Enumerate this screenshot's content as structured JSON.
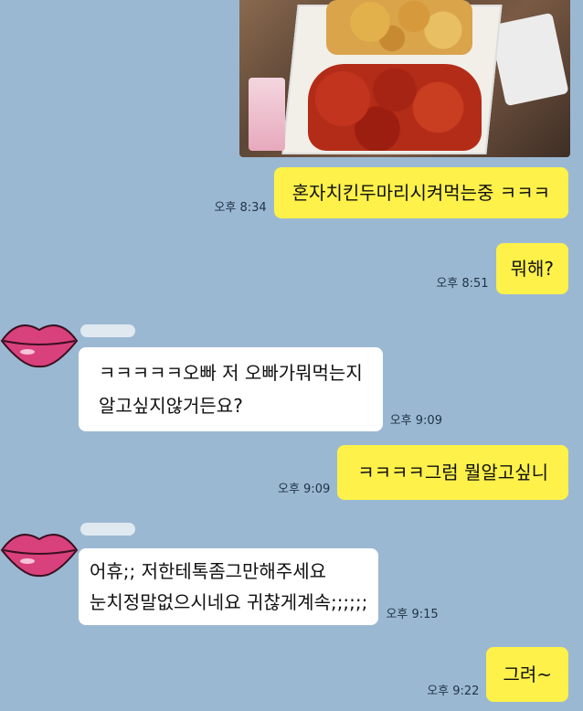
{
  "photo_alt": "",
  "messages": [
    {
      "side": "me",
      "text": "혼자치킨두마리시켜먹는중 ㅋㅋㅋ",
      "time": "오후 8:34"
    },
    {
      "side": "me",
      "text": "뭐해?",
      "time": "오후 8:51"
    },
    {
      "side": "other",
      "lines": [
        "ㅋㅋㅋㅋㅋ오빠 저 오빠가뭐먹는지",
        "알고싶지않거든요?"
      ],
      "time": "오후 9:09"
    },
    {
      "side": "me",
      "text": "ㅋㅋㅋㅋ그럼 뭘알고싶니",
      "time": "오후 9:09"
    },
    {
      "side": "other",
      "lines": [
        "어휴;; 저한테톡좀그만해주세요",
        "눈치정말없으시네요 귀찮게계속;;;;;;"
      ],
      "time": "오후 9:15"
    },
    {
      "side": "me",
      "text": "그려~",
      "time": "오후 9:22"
    }
  ],
  "colors": {
    "background": "#9bb8d3",
    "my_bubble": "#fdf14a",
    "other_bubble": "#ffffff"
  },
  "icons": {
    "avatar": "lips-icon"
  }
}
